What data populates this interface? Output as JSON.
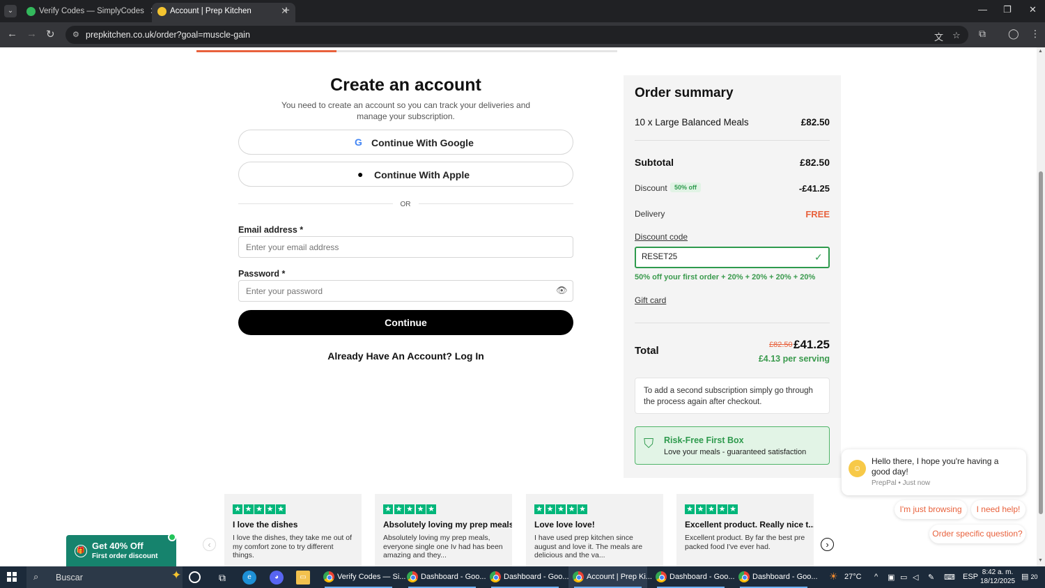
{
  "browser": {
    "tabs": [
      {
        "title": "Verify Codes — SimplyCodes",
        "active": false,
        "favicon_color": "#33b85c"
      },
      {
        "title": "Account | Prep Kitchen",
        "active": true,
        "favicon_color": "#f4c430"
      }
    ],
    "url": "prepkitchen.co.uk/order?goal=muscle-gain"
  },
  "progress": {
    "fraction": 0.333
  },
  "account": {
    "title": "Create an account",
    "subtitle": "You need to create an account so you can track your deliveries and manage your subscription.",
    "google_label": "Continue With Google",
    "apple_label": "Continue With Apple",
    "or_text": "OR",
    "email_label": "Email address *",
    "email_placeholder": "Enter your email address",
    "password_label": "Password *",
    "password_placeholder": "Enter your password",
    "continue_label": "Continue",
    "login_link": "Already Have An Account? Log In"
  },
  "summary": {
    "title": "Order summary",
    "item_label": "10 x Large Balanced Meals",
    "item_price": "£82.50",
    "subtotal_label": "Subtotal",
    "subtotal_value": "£82.50",
    "discount_label": "Discount",
    "discount_badge": "50% off",
    "discount_value": "-£41.25",
    "delivery_label": "Delivery",
    "delivery_value": "FREE",
    "discount_code_link": "Discount code",
    "discount_code_value": "RESET25",
    "discount_code_message": "50% off your first order + 20% + 20% + 20% + 20%",
    "gift_card_link": "Gift card",
    "total_label": "Total",
    "old_price": "£82.50",
    "new_price": "£41.25",
    "per_serving": "£4.13 per serving",
    "info_text": "To add a second subscription simply go through the process again after checkout.",
    "risk_title": "Risk-Free First Box",
    "risk_subtitle": "Love your meals - guaranteed satisfaction"
  },
  "reviews": [
    {
      "stars": 5,
      "title": "I love the dishes",
      "body": "I love the dishes, they take me out of my comfort zone to try different things."
    },
    {
      "stars": 5,
      "title": "Absolutely loving my prep meals",
      "body": "Absolutely loving my prep meals, everyone single one Iv had has been amazing and they..."
    },
    {
      "stars": 5,
      "title": "Love love love!",
      "body": "I have used prep kitchen since august and love it. The meals are delicious and the va..."
    },
    {
      "stars": 5,
      "title": "Excellent product. Really nice t...",
      "body": "Excellent product. By far the best pre packed food I've ever had."
    }
  ],
  "promo": {
    "title": "Get 40% Off",
    "subtitle": "First order discount"
  },
  "chat": {
    "message": "Hello there, I hope you're having a good day!",
    "meta": "PrepPal • Just now",
    "replies": [
      "I'm just browsing",
      "I need help!",
      "Order specific question?"
    ]
  },
  "taskbar": {
    "search_text": "Buscar",
    "tasks": [
      {
        "label": "Verify Codes — Si...",
        "active": false
      },
      {
        "label": "Dashboard - Goo...",
        "active": false
      },
      {
        "label": "Dashboard - Goo...",
        "active": false
      },
      {
        "label": "Account | Prep Ki...",
        "active": true
      },
      {
        "label": "Dashboard - Goo...",
        "active": false
      },
      {
        "label": "Dashboard - Goo...",
        "active": false
      }
    ],
    "weather": "27°C",
    "language": "ESP",
    "time": "8:42 a. m.",
    "date": "18/12/2025",
    "notification_count": "20"
  },
  "colors": {
    "accent": "#e8613c",
    "green": "#2e9a4d",
    "trustpilot": "#00b67a"
  }
}
